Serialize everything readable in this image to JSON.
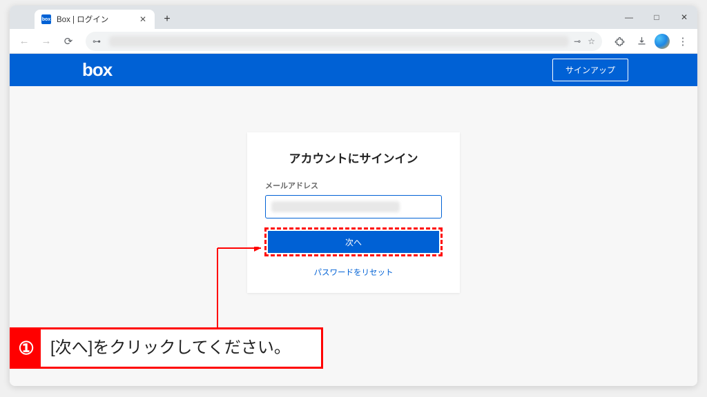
{
  "browser": {
    "tab": {
      "favicon_text": "box",
      "title": "Box | ログイン"
    },
    "controls": {
      "min": "―",
      "max": "□",
      "close": "✕"
    }
  },
  "box_header": {
    "logo": "box",
    "signup": "サインアップ"
  },
  "login": {
    "title": "アカウントにサインイン",
    "email_label": "メールアドレス",
    "next": "次へ",
    "reset": "パスワードをリセット"
  },
  "annotation": {
    "step_number": "①",
    "instruction": "[次へ]をクリックしてください。"
  },
  "colors": {
    "brand_blue": "#0061d5",
    "annotation_red": "#ff0000"
  }
}
